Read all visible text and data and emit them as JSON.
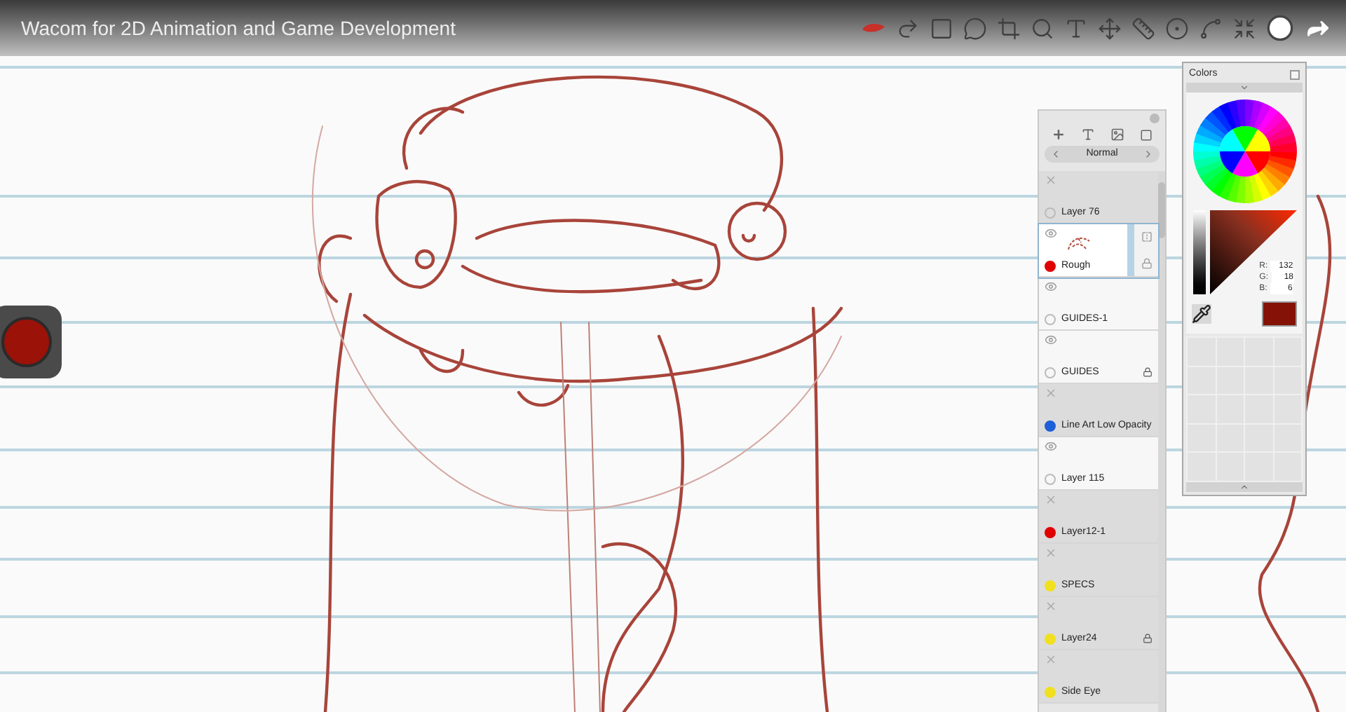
{
  "video_title": "Wacom for 2D Animation and Game Development",
  "layers_panel": {
    "blend_mode": "Normal",
    "layers": [
      {
        "name": "Layer 76",
        "visible": false,
        "locked": false,
        "selected": false
      },
      {
        "name": "Rough",
        "visible": true,
        "locked": false,
        "selected": true,
        "color": "#e00000"
      },
      {
        "name": "GUIDES-1",
        "visible": true,
        "locked": false,
        "selected": false
      },
      {
        "name": "GUIDES",
        "visible": true,
        "locked": true,
        "selected": false
      },
      {
        "name": "Line Art Low Opacity",
        "visible": false,
        "locked": false,
        "selected": false,
        "color": "#1d5fd6"
      },
      {
        "name": "Layer 115",
        "visible": true,
        "locked": false,
        "selected": false
      },
      {
        "name": "Layer12-1",
        "visible": false,
        "locked": false,
        "selected": false,
        "color": "#e00000"
      },
      {
        "name": "SPECS",
        "visible": false,
        "locked": false,
        "selected": false,
        "color": "#f0e020"
      },
      {
        "name": "Layer24",
        "visible": false,
        "locked": true,
        "selected": false,
        "color": "#f0e020"
      },
      {
        "name": "Side Eye",
        "visible": false,
        "locked": false,
        "selected": false,
        "color": "#f0e020"
      }
    ]
  },
  "colors_panel": {
    "title": "Colors",
    "channels": [
      {
        "label": "R:",
        "value": "132"
      },
      {
        "label": "G:",
        "value": "18"
      },
      {
        "label": "B:",
        "value": "6"
      }
    ]
  }
}
